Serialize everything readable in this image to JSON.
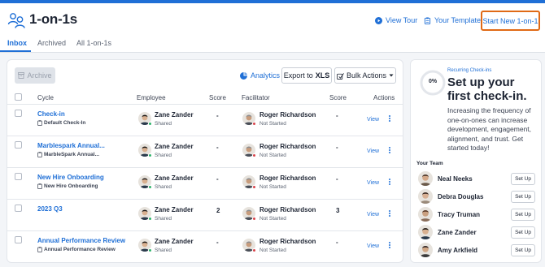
{
  "app": {
    "title": "1-on-1s",
    "view_tour": "View Tour",
    "your_templates": "Your Templates",
    "start_new": "Start New 1-on-1",
    "accent_color": "#1f6fd6",
    "highlight_color": "#e06a16"
  },
  "tabs": [
    {
      "label": "Inbox",
      "active": true
    },
    {
      "label": "Archived",
      "active": false
    },
    {
      "label": "All 1-on-1s",
      "active": false
    }
  ],
  "toolbar": {
    "archive": "Archive",
    "analytics": "Analytics",
    "export_prefix": "Export to",
    "export_format": "XLS",
    "bulk_actions": "Bulk Actions"
  },
  "table": {
    "columns": [
      "Cycle",
      "Employee",
      "Score",
      "Facilitator",
      "Score",
      "Actions"
    ],
    "rows": [
      {
        "cycle": "Check-in",
        "template": "Default Check-In",
        "employee": "Zane Zander",
        "employee_status": "Shared",
        "employee_score": "-",
        "facilitator": "Roger Richardson",
        "facilitator_status": "Not Started",
        "facilitator_score": "-",
        "action": "View"
      },
      {
        "cycle": "Marblespark Annual...",
        "template": "MarbleSpark Annual...",
        "employee": "Zane Zander",
        "employee_status": "Shared",
        "employee_score": "-",
        "facilitator": "Roger Richardson",
        "facilitator_status": "Not Started",
        "facilitator_score": "-",
        "action": "View"
      },
      {
        "cycle": "New Hire Onboarding",
        "template": "New Hire Onboarding",
        "employee": "Zane Zander",
        "employee_status": "Shared",
        "employee_score": "-",
        "facilitator": "Roger Richardson",
        "facilitator_status": "Not Started",
        "facilitator_score": "-",
        "action": "View"
      },
      {
        "cycle": "2023 Q3",
        "template": "",
        "employee": "Zane Zander",
        "employee_status": "Shared",
        "employee_score": "2",
        "facilitator": "Roger Richardson",
        "facilitator_status": "Not Started",
        "facilitator_score": "3",
        "action": "View"
      },
      {
        "cycle": "Annual Performance Review",
        "template": "Annual Performance Review",
        "employee": "Zane Zander",
        "employee_status": "Shared",
        "employee_score": "-",
        "facilitator": "Roger Richardson",
        "facilitator_status": "Not Started",
        "facilitator_score": "-",
        "action": "View"
      }
    ]
  },
  "sidebar": {
    "progress": "0%",
    "eyebrow": "Recurring Check-ins",
    "headline": "Set up your first check-in.",
    "description": "Increasing the frequency of one-on-ones can increase development, engagement, alignment, and trust. Get started today!",
    "team_label": "Your Team",
    "team": [
      {
        "name": "Neal Neeks",
        "action": "Set Up"
      },
      {
        "name": "Debra Douglas",
        "action": "Set Up"
      },
      {
        "name": "Tracy Truman",
        "action": "Set Up"
      },
      {
        "name": "Zane Zander",
        "action": "Set Up"
      },
      {
        "name": "Amy Arkfield",
        "action": "Set Up"
      }
    ]
  }
}
